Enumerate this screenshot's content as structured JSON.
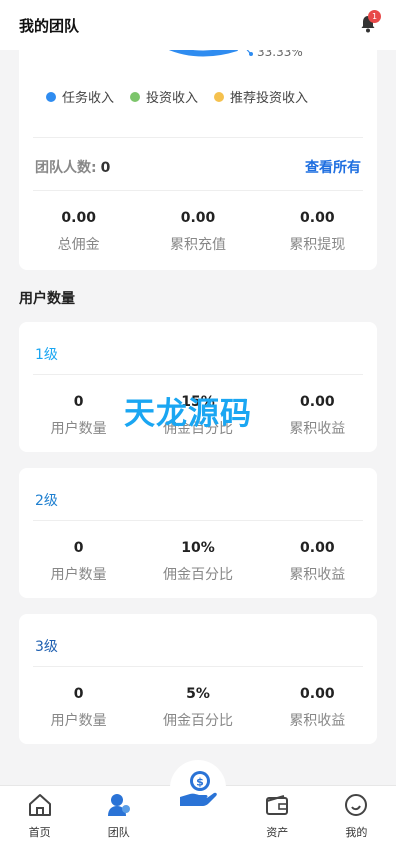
{
  "header": {
    "title": "我的团队",
    "badge_count": "1"
  },
  "chart": {
    "percent_label": "33.33%",
    "legend": [
      {
        "label": "任务收入",
        "color": "#2f8cf0"
      },
      {
        "label": "投资收入",
        "color": "#7cc56b"
      },
      {
        "label": "推荐投资收入",
        "color": "#f5c14e"
      }
    ]
  },
  "team": {
    "label": "团队人数:",
    "count": "0",
    "view_all": "查看所有",
    "stats": [
      {
        "value": "0.00",
        "label": "总佣金"
      },
      {
        "value": "0.00",
        "label": "累积充值"
      },
      {
        "value": "0.00",
        "label": "累积提现"
      }
    ]
  },
  "section_title": "用户数量",
  "levels": [
    {
      "title": "1级",
      "title_color": "#1aa6f2",
      "stats": [
        {
          "value": "0",
          "label": "用户数量"
        },
        {
          "value": "15%",
          "label": "佣金百分比"
        },
        {
          "value": "0.00",
          "label": "累积收益"
        }
      ]
    },
    {
      "title": "2级",
      "title_color": "#1e7fd0",
      "stats": [
        {
          "value": "0",
          "label": "用户数量"
        },
        {
          "value": "10%",
          "label": "佣金百分比"
        },
        {
          "value": "0.00",
          "label": "累积收益"
        }
      ]
    },
    {
      "title": "3级",
      "title_color": "#1e5fb0",
      "stats": [
        {
          "value": "0",
          "label": "用户数量"
        },
        {
          "value": "5%",
          "label": "佣金百分比"
        },
        {
          "value": "0.00",
          "label": "累积收益"
        }
      ]
    }
  ],
  "watermark": "天龙源码",
  "tabbar": {
    "items": [
      {
        "label": "首页",
        "icon": "home-icon"
      },
      {
        "label": "团队",
        "icon": "team-icon"
      },
      {
        "label": "资产",
        "icon": "wallet-icon"
      },
      {
        "label": "我的",
        "icon": "profile-icon"
      }
    ],
    "center_icon": "money-hand-icon"
  }
}
